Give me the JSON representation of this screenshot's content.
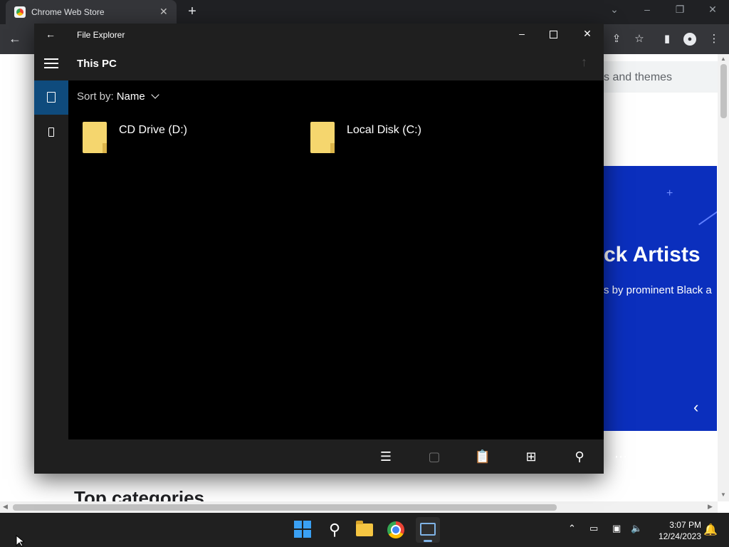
{
  "chrome": {
    "tab_title": "Chrome Web Store",
    "tab_close": "✕",
    "new_tab": "+",
    "page": {
      "search_hint": "s and themes",
      "banner_title": "ck Artists",
      "banner_subtitle": "s by prominent Black a",
      "section_heading": "Top categories"
    }
  },
  "explorer": {
    "window_title": "File Explorer",
    "location": "This PC",
    "sort_label": "Sort by:",
    "sort_value": "Name",
    "drives": [
      {
        "label": "CD Drive (D:)"
      },
      {
        "label": "Local Disk (C:)"
      }
    ],
    "icons": {
      "back": "arrow-left-icon",
      "minimize": "minimize-icon",
      "maximize": "maximize-icon",
      "close": "close-icon",
      "up": "arrow-up-icon",
      "menu": "hamburger-icon",
      "rail": [
        "this-pc-icon",
        "usb-drive-icon"
      ],
      "commands": [
        "select-list-icon",
        "new-item-icon",
        "paste-icon",
        "view-grid-icon",
        "search-icon",
        "more-icon"
      ]
    }
  },
  "taskbar": {
    "time": "3:07 PM",
    "date": "12/24/2023",
    "colors": {
      "accent": "#3aa0f3",
      "explorer_selected": "#0f4b7d"
    }
  }
}
